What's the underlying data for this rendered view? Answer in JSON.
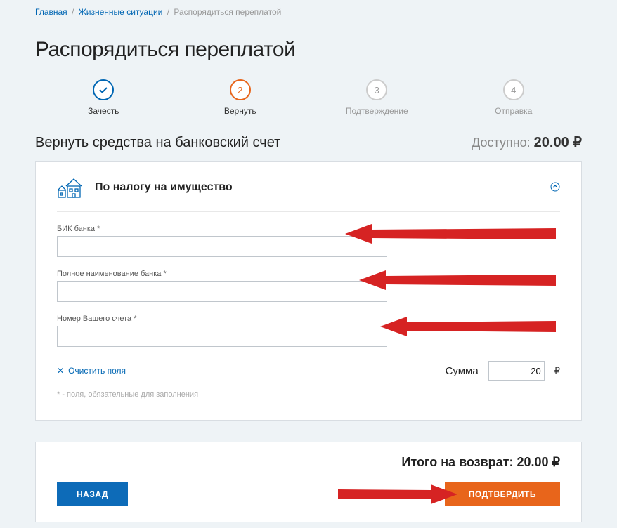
{
  "breadcrumb": {
    "home": "Главная",
    "life": "Жизненные ситуации",
    "current": "Распорядиться переплатой"
  },
  "page_title": "Распорядиться переплатой",
  "steps": [
    {
      "num": "✓",
      "label": "Зачесть",
      "state": "done"
    },
    {
      "num": "2",
      "label": "Вернуть",
      "state": "active"
    },
    {
      "num": "3",
      "label": "Подтверждение",
      "state": ""
    },
    {
      "num": "4",
      "label": "Отправка",
      "state": ""
    }
  ],
  "sub": {
    "title": "Вернуть средства на банковский счет",
    "avail_label": "Доступно: ",
    "avail_value": "20.00 ₽"
  },
  "card": {
    "title": "По налогу на имущество",
    "fields": {
      "bik_label": "БИК банка *",
      "bankname_label": "Полное наименование банка *",
      "account_label": "Номер Вашего счета *"
    },
    "clear": "Очистить поля",
    "sum_label": "Сумма",
    "sum_value": "20",
    "sum_cur": "₽",
    "note": "* - поля, обязательные для заполнения"
  },
  "footer": {
    "total_label": "Итого на возврат: ",
    "total_value": "20.00 ₽",
    "back": "НАЗАД",
    "confirm": "ПОДТВЕРДИТЬ"
  }
}
